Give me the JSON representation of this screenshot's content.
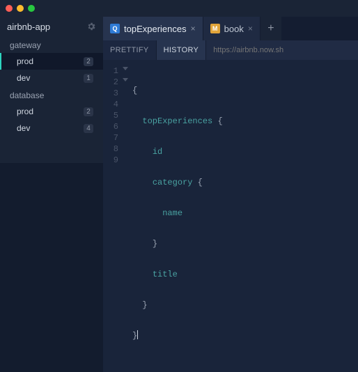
{
  "app": {
    "title": "airbnb-app"
  },
  "sidebar": {
    "groups": [
      {
        "label": "gateway",
        "items": [
          {
            "name": "prod",
            "badge": "2",
            "selected": true
          },
          {
            "name": "dev",
            "badge": "1",
            "selected": false
          }
        ]
      },
      {
        "label": "database",
        "items": [
          {
            "name": "prod",
            "badge": "2",
            "selected": false
          },
          {
            "name": "dev",
            "badge": "4",
            "selected": false
          }
        ]
      }
    ]
  },
  "tabs": [
    {
      "kind": "Q",
      "label": "topExperiences",
      "active": true
    },
    {
      "kind": "M",
      "label": "book",
      "active": false
    }
  ],
  "toolbar": {
    "prettify_label": "PRETTIFY",
    "history_label": "HISTORY",
    "url_placeholder": "https://airbnb.now.sh"
  },
  "editor": {
    "lines": [
      {
        "n": "1",
        "text": "{",
        "fold": true
      },
      {
        "n": "2",
        "text": "  topExperiences {",
        "fold": true
      },
      {
        "n": "3",
        "text": "    id"
      },
      {
        "n": "4",
        "text": "    category {"
      },
      {
        "n": "5",
        "text": "      name"
      },
      {
        "n": "6",
        "text": "    }"
      },
      {
        "n": "7",
        "text": "    title"
      },
      {
        "n": "8",
        "text": "  }"
      },
      {
        "n": "9",
        "text": "}"
      }
    ]
  }
}
